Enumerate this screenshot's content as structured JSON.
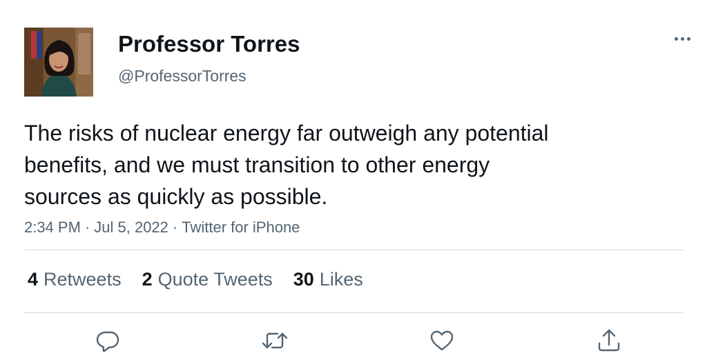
{
  "author": {
    "display_name": "Professor Torres",
    "handle": "@ProfessorTorres"
  },
  "tweet": {
    "text_lines": [
      "The risks of nuclear energy far outweigh any potential",
      "benefits, and we must transition to other energy",
      "sources as quickly as possible."
    ],
    "time": "2:34 PM",
    "date": "Jul 5, 2022",
    "source": "Twitter for iPhone",
    "separator": "·"
  },
  "stats": {
    "retweets": {
      "count": "4",
      "label": "Retweets"
    },
    "quote_tweets": {
      "count": "2",
      "label": "Quote Tweets"
    },
    "likes": {
      "count": "30",
      "label": "Likes"
    }
  },
  "icons": {
    "more": "more-horizontal-icon",
    "reply": "reply-icon",
    "retweet": "retweet-icon",
    "like": "heart-icon",
    "share": "share-icon"
  },
  "colors": {
    "text_primary": "#0f1419",
    "text_secondary": "#536471",
    "divider": "#cfd9de"
  }
}
